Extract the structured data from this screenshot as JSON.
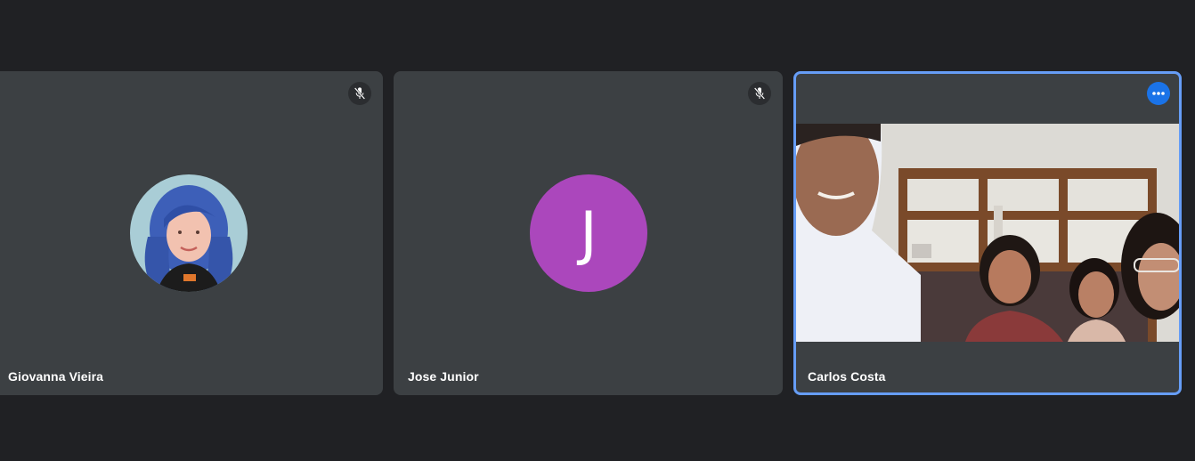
{
  "participants": [
    {
      "name": "Giovanna Vieira",
      "muted": true,
      "avatar_type": "photo"
    },
    {
      "name": "Jose Junior",
      "muted": true,
      "avatar_type": "letter",
      "initial": "J",
      "avatar_color": "#ab47bc"
    },
    {
      "name": "Carlos Costa",
      "muted": false,
      "video_on": true,
      "active": true
    }
  ],
  "colors": {
    "background": "#202124",
    "tile": "#3c4043",
    "active_border": "#669df6",
    "more_button": "#1a73e8"
  },
  "icons": [
    "mic-off-icon",
    "more-options-icon"
  ]
}
